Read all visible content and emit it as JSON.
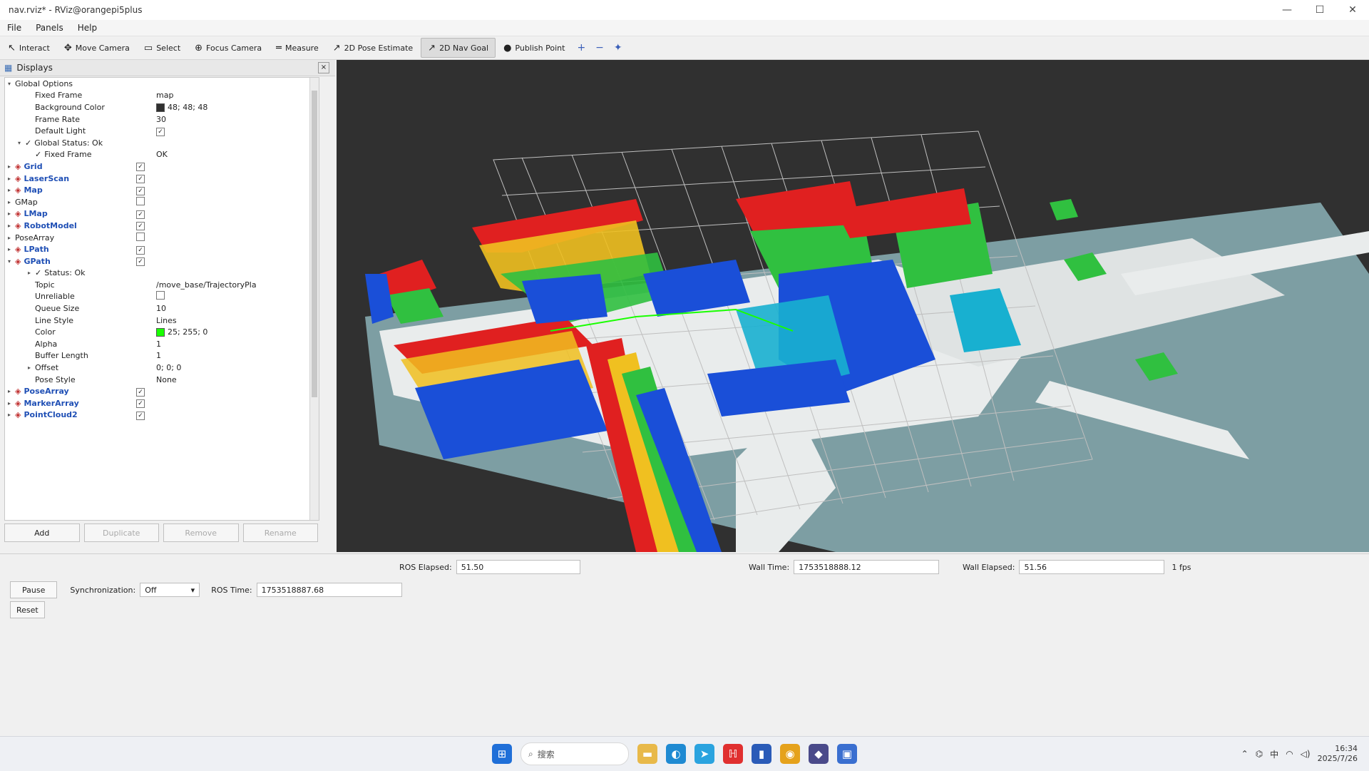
{
  "window": {
    "title": "nav.rviz* - RViz@orangepi5plus",
    "controls": [
      "—",
      "☐",
      "✕"
    ]
  },
  "menu": [
    "File",
    "Panels",
    "Help"
  ],
  "toolbar": {
    "tools": [
      {
        "label": "Interact",
        "icon": "interact-icon",
        "glyph": "↖",
        "active": false
      },
      {
        "label": "Move Camera",
        "icon": "move-camera-icon",
        "glyph": "✥",
        "active": false
      },
      {
        "label": "Select",
        "icon": "select-icon",
        "glyph": "▭",
        "active": false
      },
      {
        "label": "Focus Camera",
        "icon": "focus-camera-icon",
        "glyph": "⊕",
        "active": false
      },
      {
        "label": "Measure",
        "icon": "measure-icon",
        "glyph": "═",
        "active": false
      },
      {
        "label": "2D Pose Estimate",
        "icon": "pose-estimate-icon",
        "glyph": "↗",
        "active": false
      },
      {
        "label": "2D Nav Goal",
        "icon": "nav-goal-icon",
        "glyph": "↗",
        "active": true
      },
      {
        "label": "Publish Point",
        "icon": "publish-point-icon",
        "glyph": "●",
        "active": false
      }
    ],
    "extras": [
      "+",
      "−",
      "✦"
    ]
  },
  "displays": {
    "title": "Displays",
    "rows": [
      {
        "name": "Global Options",
        "value": "",
        "indent": 0,
        "arrow": "▾",
        "kind": "header"
      },
      {
        "name": "Fixed Frame",
        "value": "map",
        "indent": 2
      },
      {
        "name": "Background Color",
        "value": "48; 48; 48",
        "indent": 2,
        "swatch": "#303030"
      },
      {
        "name": "Frame Rate",
        "value": "30",
        "indent": 2
      },
      {
        "name": "Default Light",
        "value": "",
        "indent": 2,
        "checked": true
      },
      {
        "name": "Global Status: Ok",
        "value": "",
        "indent": 1,
        "arrow": "▾",
        "status": true
      },
      {
        "name": "Fixed Frame",
        "value": "OK",
        "indent": 2,
        "status": true
      },
      {
        "name": "Grid",
        "value": "",
        "indent": 0,
        "arrow": "▸",
        "display": true,
        "checked": true
      },
      {
        "name": "LaserScan",
        "value": "",
        "indent": 0,
        "arrow": "▸",
        "display": true,
        "checked": true
      },
      {
        "name": "Map",
        "value": "",
        "indent": 0,
        "arrow": "▸",
        "display": true,
        "checked": true
      },
      {
        "name": "GMap",
        "value": "",
        "indent": 0,
        "arrow": "▸",
        "checked": false
      },
      {
        "name": "LMap",
        "value": "",
        "indent": 0,
        "arrow": "▸",
        "display": true,
        "checked": true
      },
      {
        "name": "RobotModel",
        "value": "",
        "indent": 0,
        "arrow": "▸",
        "display": true,
        "checked": true
      },
      {
        "name": "PoseArray",
        "value": "",
        "indent": 0,
        "arrow": "▸",
        "checked": false
      },
      {
        "name": "LPath",
        "value": "",
        "indent": 0,
        "arrow": "▸",
        "display": true,
        "checked": true
      },
      {
        "name": "GPath",
        "value": "",
        "indent": 0,
        "arrow": "▾",
        "display": true,
        "checked": true
      },
      {
        "name": "Status: Ok",
        "value": "",
        "indent": 2,
        "arrow": "▸",
        "status": true
      },
      {
        "name": "Topic",
        "value": "/move_base/TrajectoryPla",
        "indent": 2
      },
      {
        "name": "Unreliable",
        "value": "",
        "indent": 2,
        "checked": false
      },
      {
        "name": "Queue Size",
        "value": "10",
        "indent": 2
      },
      {
        "name": "Line Style",
        "value": "Lines",
        "indent": 2
      },
      {
        "name": "Color",
        "value": "25; 255; 0",
        "indent": 2,
        "swatch": "#19ff00"
      },
      {
        "name": "Alpha",
        "value": "1",
        "indent": 2
      },
      {
        "name": "Buffer Length",
        "value": "1",
        "indent": 2
      },
      {
        "name": "Offset",
        "value": "0; 0; 0",
        "indent": 2,
        "arrow": "▸"
      },
      {
        "name": "Pose Style",
        "value": "None",
        "indent": 2
      },
      {
        "name": "PoseArray",
        "value": "",
        "indent": 0,
        "arrow": "▸",
        "display": true,
        "checked": true
      },
      {
        "name": "MarkerArray",
        "value": "",
        "indent": 0,
        "arrow": "▸",
        "display": true,
        "checked": true
      },
      {
        "name": "PointCloud2",
        "value": "",
        "indent": 0,
        "arrow": "▸",
        "display": true,
        "checked": true
      }
    ],
    "buttons": [
      {
        "label": "Add",
        "enabled": true
      },
      {
        "label": "Duplicate",
        "enabled": false
      },
      {
        "label": "Remove",
        "enabled": false
      },
      {
        "label": "Rename",
        "enabled": false
      }
    ]
  },
  "time": {
    "pause_label": "Pause",
    "sync_label": "Synchronization:",
    "sync_value": "Off",
    "ros_time_label": "ROS Time:",
    "ros_time": "1753518887.68",
    "ros_elapsed_label": "ROS Elapsed:",
    "ros_elapsed": "51.50",
    "wall_time_label": "Wall Time:",
    "wall_time": "1753518888.12",
    "wall_elapsed_label": "Wall Elapsed:",
    "wall_elapsed": "51.56",
    "fps": "1 fps",
    "reset_label": "Reset"
  },
  "taskbar": {
    "search_placeholder": "搜索",
    "time": "16:34",
    "date": "2025/7/26",
    "apps": [
      {
        "name": "file-explorer-icon",
        "glyph": "▬",
        "color": "#e8b94a"
      },
      {
        "name": "edge-icon",
        "glyph": "◐",
        "color": "#1f8ad2"
      },
      {
        "name": "telegram-icon",
        "glyph": "➤",
        "color": "#2aa3df"
      },
      {
        "name": "app-red-icon",
        "glyph": "ℍ",
        "color": "#e03030"
      },
      {
        "name": "app-blue-icon",
        "glyph": "▮",
        "color": "#2a5bb8"
      },
      {
        "name": "chrome-icon",
        "glyph": "◉",
        "color": "#e5a21c"
      },
      {
        "name": "app-tool-icon",
        "glyph": "◆",
        "color": "#4a4a8a"
      },
      {
        "name": "app-running-icon",
        "glyph": "▣",
        "color": "#3a6fd0"
      }
    ]
  }
}
